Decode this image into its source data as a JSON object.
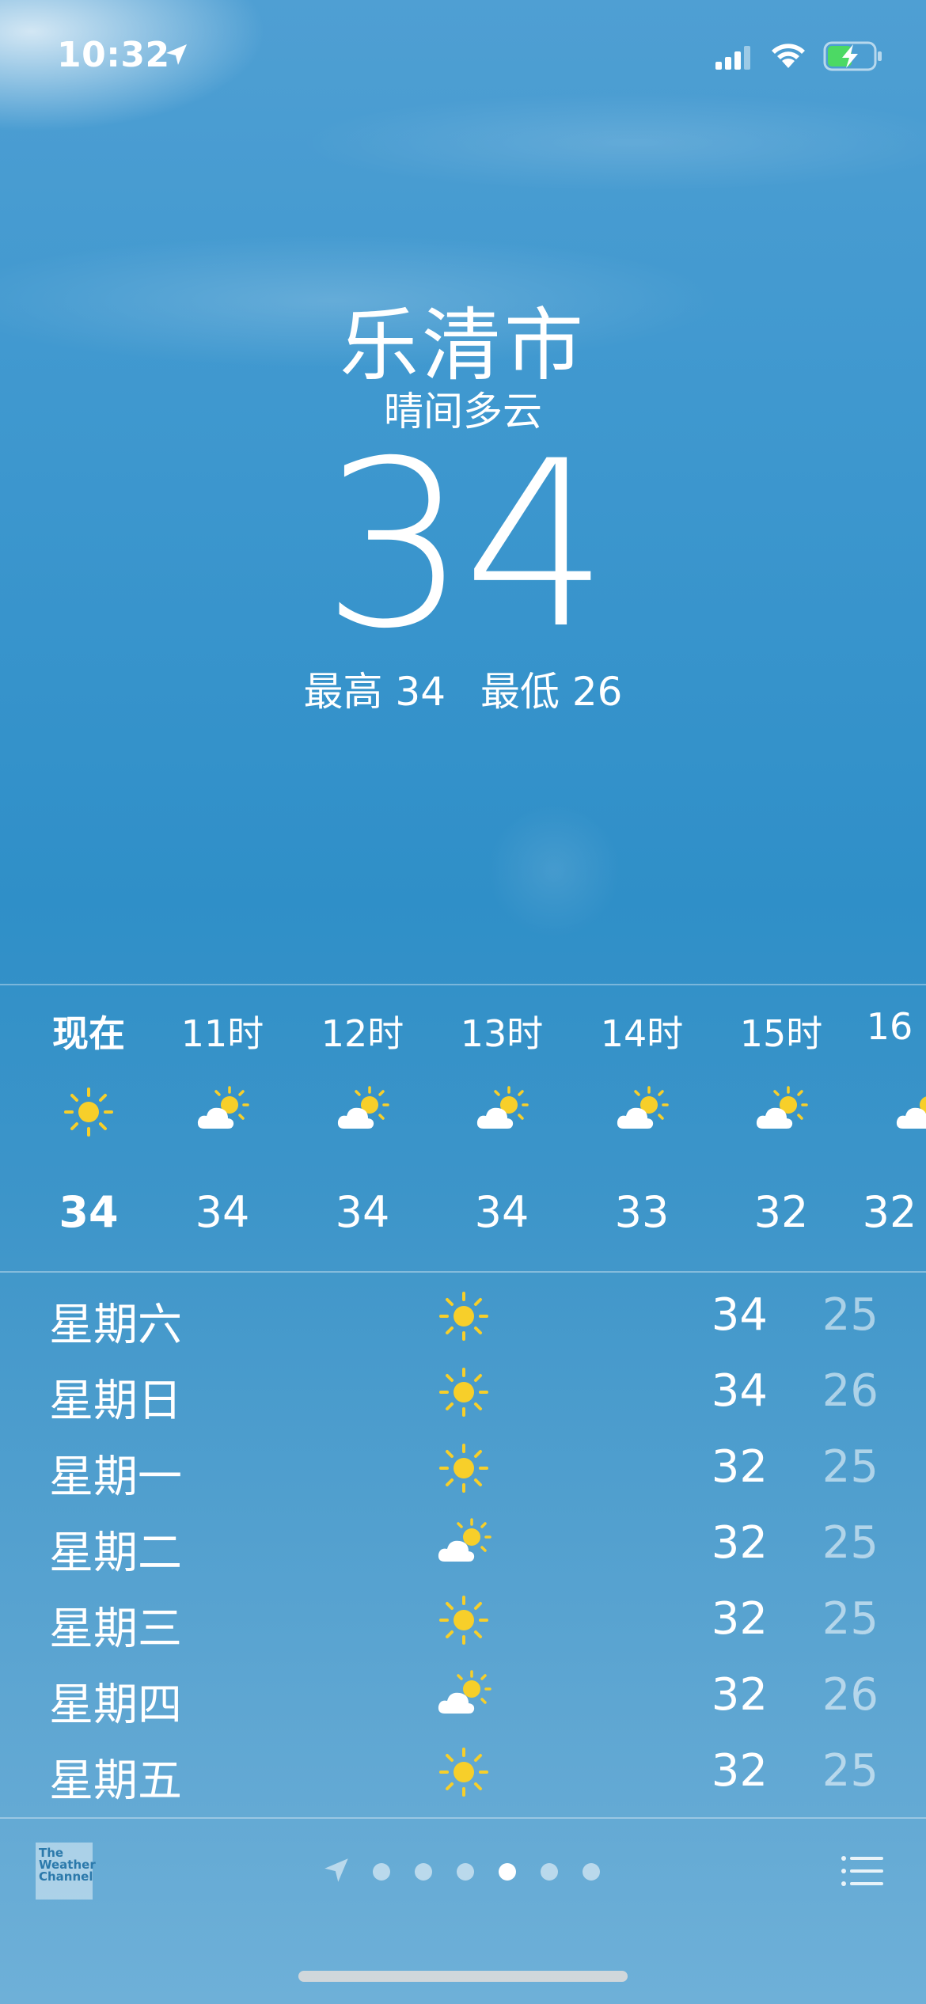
{
  "status_bar": {
    "time": "10:32"
  },
  "header": {
    "city": "乐清市",
    "condition": "晴间多云",
    "temperature": "34",
    "high": "最高 34",
    "low": "最低 26"
  },
  "hourly": [
    {
      "label": "现在",
      "icon": "sun-icon",
      "temp": "34"
    },
    {
      "label": "11时",
      "icon": "partly-cloudy-icon",
      "temp": "34"
    },
    {
      "label": "12时",
      "icon": "partly-cloudy-icon",
      "temp": "34"
    },
    {
      "label": "13时",
      "icon": "partly-cloudy-icon",
      "temp": "34"
    },
    {
      "label": "14时",
      "icon": "partly-cloudy-icon",
      "temp": "33"
    },
    {
      "label": "15时",
      "icon": "partly-cloudy-icon",
      "temp": "32"
    },
    {
      "label": "16",
      "icon": "partly-cloudy-icon",
      "temp": "32"
    }
  ],
  "daily": [
    {
      "day": "星期六",
      "icon": "sun-icon",
      "high": "34",
      "low": "25"
    },
    {
      "day": "星期日",
      "icon": "sun-icon",
      "high": "34",
      "low": "26"
    },
    {
      "day": "星期一",
      "icon": "sun-icon",
      "high": "32",
      "low": "25"
    },
    {
      "day": "星期二",
      "icon": "partly-cloudy-icon",
      "high": "32",
      "low": "25"
    },
    {
      "day": "星期三",
      "icon": "sun-icon",
      "high": "32",
      "low": "25"
    },
    {
      "day": "星期四",
      "icon": "partly-cloudy-icon",
      "high": "32",
      "low": "26"
    },
    {
      "day": "星期五",
      "icon": "sun-icon",
      "high": "32",
      "low": "25"
    }
  ],
  "footer": {
    "provider_logo_text": "The Weather Channel",
    "page_count": 6,
    "active_page": 4
  },
  "colors": {
    "sun": "#f7cf2a",
    "sky": "#2f8fc8",
    "low_temp_text": "rgba(255,255,255,0.55)"
  }
}
